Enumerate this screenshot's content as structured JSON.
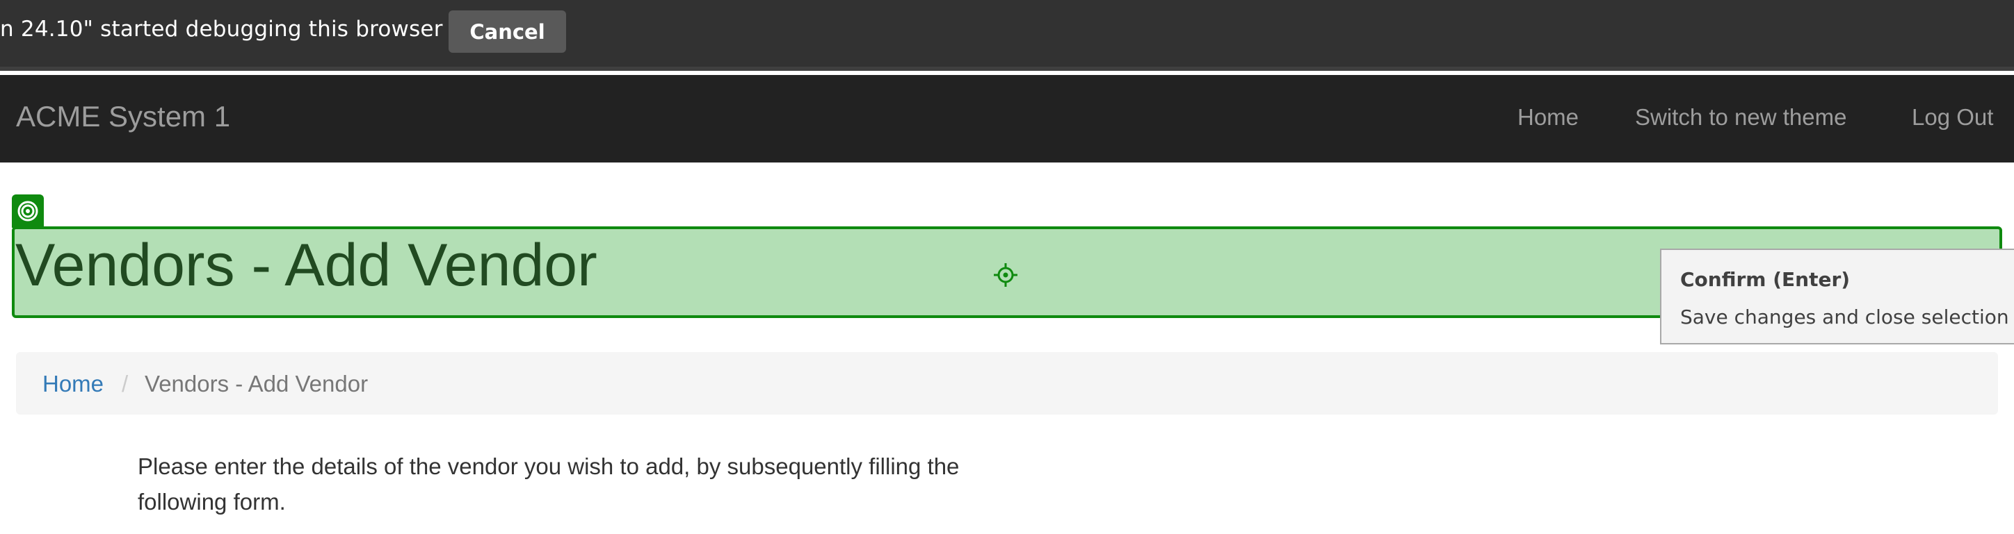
{
  "debug_bar": {
    "message": "n 24.10\" started debugging this browser",
    "cancel_label": "Cancel"
  },
  "navbar": {
    "brand": "ACME System 1",
    "links": {
      "home": "Home",
      "switch_theme": "Switch to new theme",
      "logout": "Log Out"
    }
  },
  "page": {
    "title": "Vendors - Add Vendor",
    "breadcrumb": {
      "home": "Home",
      "separator": "/",
      "current": "Vendors - Add Vendor"
    },
    "intro": "Please enter the details of the vendor you wish to add, by subsequently filling the following form."
  },
  "tooltip": {
    "title": "Confirm (Enter)",
    "description": "Save changes and close selection wiz"
  },
  "colors": {
    "highlight_border": "#0f8a0f",
    "highlight_fill": "#b3dfb5",
    "navbar_bg": "#222222",
    "link": "#337ab7"
  }
}
